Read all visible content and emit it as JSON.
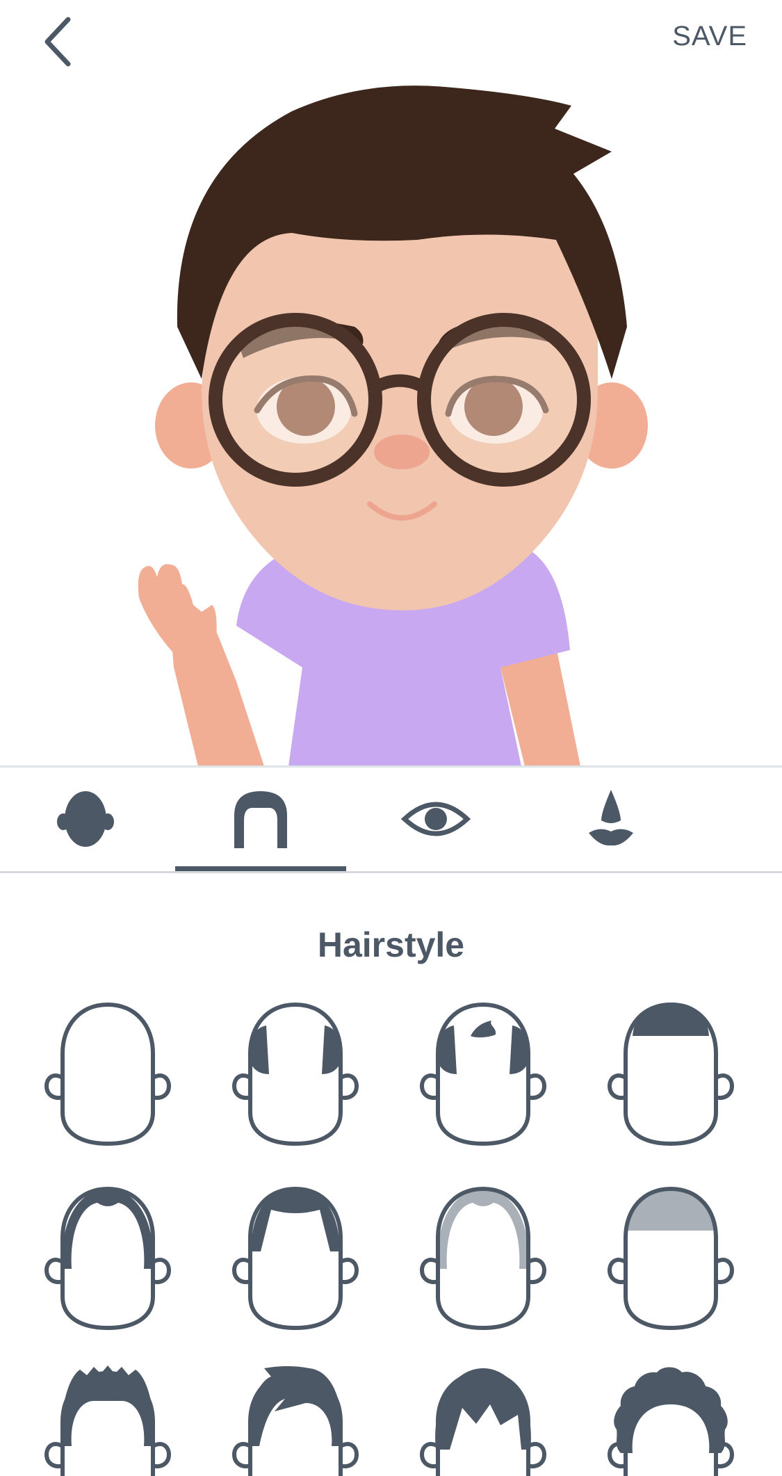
{
  "header": {
    "save_label": "SAVE",
    "back_icon": "chevron-left-icon"
  },
  "tabs": [
    {
      "icon": "face-shape-icon",
      "selected": false
    },
    {
      "icon": "hairstyle-icon",
      "selected": true
    },
    {
      "icon": "eye-icon",
      "selected": false
    },
    {
      "icon": "nose-mouth-icon",
      "selected": false
    },
    {
      "icon": "mustache-icon",
      "selected": false
    }
  ],
  "section": {
    "title": "Hairstyle"
  },
  "hairstyle_options": [
    "bald",
    "side-hair",
    "balding-tuft",
    "flat-top",
    "thin-part",
    "widows-peak",
    "gray-receding",
    "gray-flat",
    "spiky",
    "side-swept",
    "fringe",
    "curly"
  ],
  "colors": {
    "icon_gray": "#4d5866",
    "hair": "#3d271d",
    "skin": "#f2c5ae",
    "shirt": "#c9a8f2",
    "glasses": "#4b3329",
    "eye": "#7b4b35"
  }
}
